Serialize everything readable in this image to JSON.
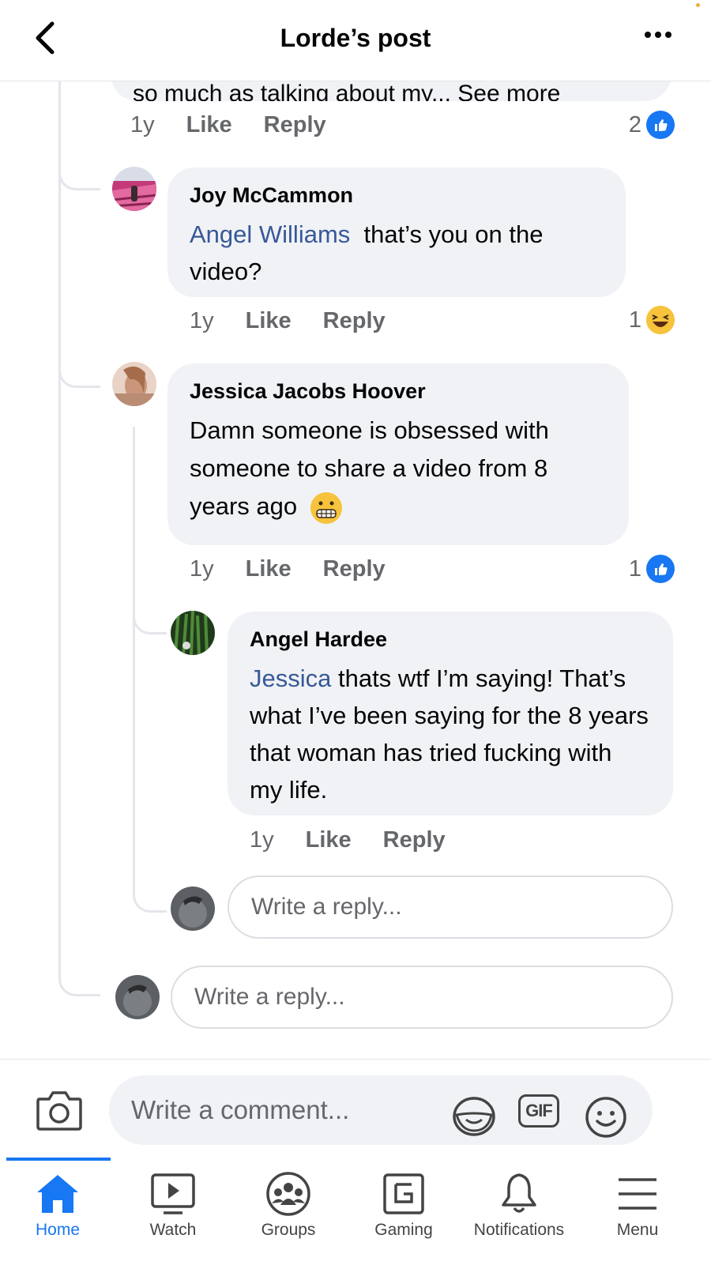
{
  "header": {
    "title": "Lorde’s post"
  },
  "top_comment": {
    "truncated_text": "so much as talking about my... See more",
    "time": "1y",
    "like": "Like",
    "reply": "Reply",
    "reaction_count": "2"
  },
  "comments": [
    {
      "author": "Joy McCammon",
      "mention": "Angel Williams",
      "text": "that’s you on the video?",
      "time": "1y",
      "like": "Like",
      "reply": "Reply",
      "reaction_count": "1"
    },
    {
      "author": "Jessica Jacobs Hoover",
      "text": "Damn someone is obsessed with someone to share a video from 8 years ago",
      "time": "1y",
      "like": "Like",
      "reply": "Reply",
      "reaction_count": "1"
    },
    {
      "author": "Angel Hardee",
      "mention": "Jessica",
      "text": "thats wtf I’m saying! That’s what I’ve been saying for the 8 years that woman has tried fucking with my life.",
      "time": "1y",
      "like": "Like",
      "reply": "Reply"
    }
  ],
  "reply_inputs": {
    "nested_placeholder": "Write a reply...",
    "thread_placeholder": "Write a reply..."
  },
  "composer": {
    "placeholder": "Write a comment...",
    "gif_label": "GIF"
  },
  "tabs": [
    {
      "label": "Home",
      "icon": "home-icon",
      "active": true
    },
    {
      "label": "Watch",
      "icon": "watch-icon"
    },
    {
      "label": "Groups",
      "icon": "groups-icon"
    },
    {
      "label": "Gaming",
      "icon": "gaming-icon"
    },
    {
      "label": "Notifications",
      "icon": "bell-icon"
    },
    {
      "label": "Menu",
      "icon": "menu-icon"
    }
  ],
  "colors": {
    "accent": "#1877f2",
    "mention": "#385898",
    "bubble": "#f0f2f5",
    "secondary_text": "#65676b"
  }
}
